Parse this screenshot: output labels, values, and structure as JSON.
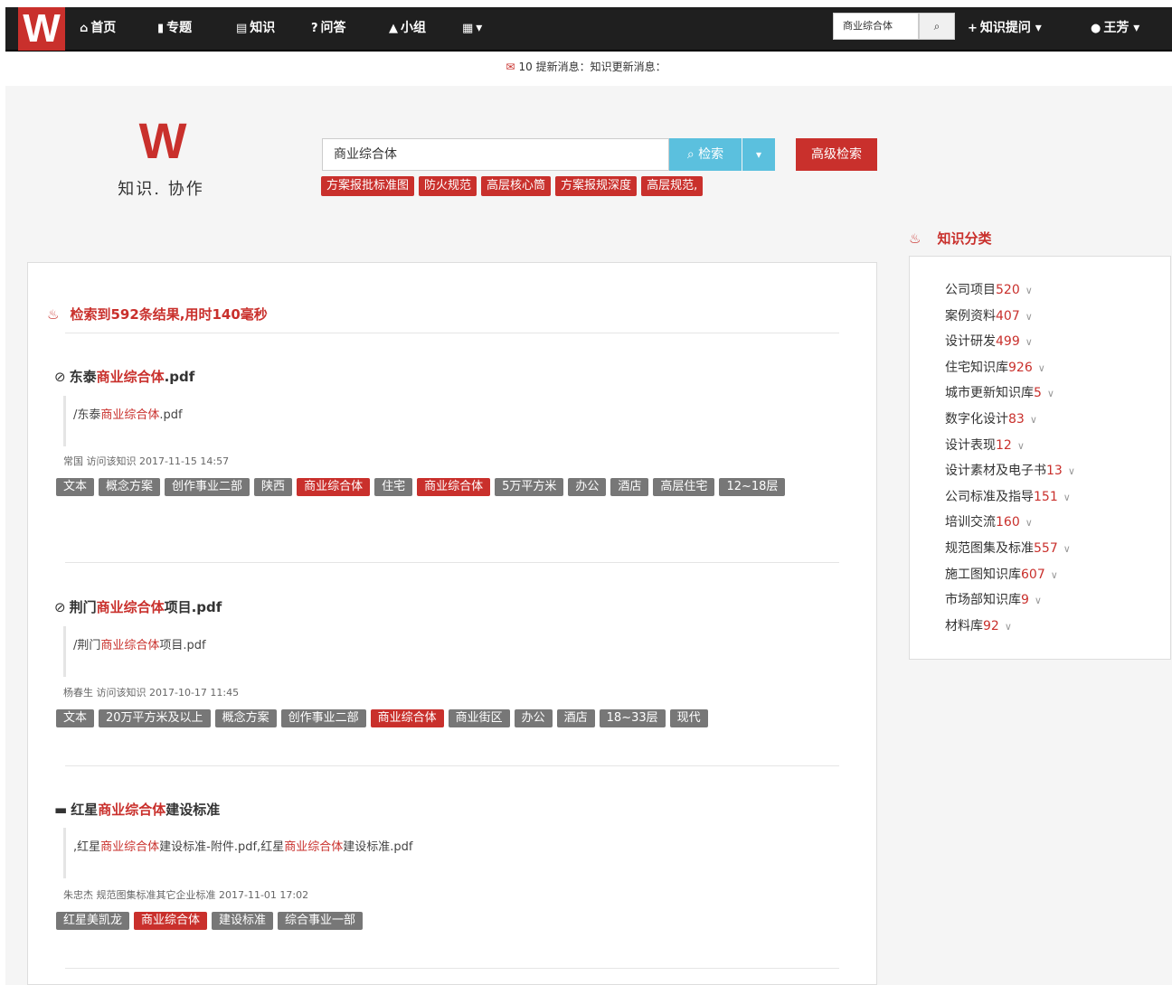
{
  "nav": {
    "logo": "W",
    "items": [
      {
        "icon": "home-icon",
        "glyph": "⌂",
        "label": "首页"
      },
      {
        "icon": "bookmark-icon",
        "glyph": "▮",
        "label": "专题"
      },
      {
        "icon": "book-icon",
        "glyph": "▤",
        "label": "知识"
      },
      {
        "icon": "question-icon",
        "glyph": "?",
        "label": "问答"
      },
      {
        "icon": "bell-icon",
        "glyph": "▲",
        "label": "小组"
      },
      {
        "icon": "grid-icon",
        "glyph": "▦",
        "label": "▾"
      }
    ],
    "search_value": "商业综合体",
    "search_icon": "⌕",
    "ask_glyph": "+",
    "ask_label": "知识提问 ▾",
    "user_glyph": "●",
    "user_label": "王芳 ▾"
  },
  "notify": {
    "mail_icon": "✉",
    "text": "10 提新消息：知识更新消息："
  },
  "brand": {
    "mark": "W",
    "slogan": "知识. 协作"
  },
  "search": {
    "value": "商业综合体",
    "button_label": "⌕ 检索",
    "caret": "▾",
    "advanced_label": "高级检索",
    "hot_tags": [
      "方案报批标准图",
      "防火规范",
      "高层核心筒",
      "方案报规深度",
      "高层规范,"
    ]
  },
  "results": {
    "fire_icon": "♨",
    "summary": "检索到592条结果,用时140毫秒",
    "items": [
      {
        "icon_glyph": "⊘",
        "icon_name": "paperclip-icon",
        "title_pre": "东泰",
        "title_hl": "商业综合体",
        "title_post": ".pdf",
        "path_pre": "/东泰",
        "path_hl": "商业综合体",
        "path_post": ".pdf",
        "path2_hl": "",
        "path2_post": "",
        "meta": "常国 访问该知识 2017-11-15 14:57",
        "tags": [
          {
            "t": "文本",
            "red": false
          },
          {
            "t": "概念方案",
            "red": false
          },
          {
            "t": "创作事业二部",
            "red": false
          },
          {
            "t": "陕西",
            "red": false
          },
          {
            "t": "商业综合体",
            "red": true
          },
          {
            "t": "住宅",
            "red": false
          },
          {
            "t": "商业综合体",
            "red": true
          },
          {
            "t": "5万平方米",
            "red": false
          },
          {
            "t": "办公",
            "red": false
          },
          {
            "t": "酒店",
            "red": false
          },
          {
            "t": "高层住宅",
            "red": false
          },
          {
            "t": "12~18层",
            "red": false
          }
        ]
      },
      {
        "icon_glyph": "⊘",
        "icon_name": "paperclip-icon",
        "title_pre": "荆门",
        "title_hl": "商业综合体",
        "title_post": "项目.pdf",
        "path_pre": "/荆门",
        "path_hl": "商业综合体",
        "path_post": "项目.pdf",
        "path2_hl": "",
        "path2_post": "",
        "meta": "杨春生 访问该知识 2017-10-17 11:45",
        "tags": [
          {
            "t": "文本",
            "red": false
          },
          {
            "t": "20万平方米及以上",
            "red": false
          },
          {
            "t": "概念方案",
            "red": false
          },
          {
            "t": "创作事业二部",
            "red": false
          },
          {
            "t": "商业综合体",
            "red": true
          },
          {
            "t": "商业街区",
            "red": false
          },
          {
            "t": "办公",
            "red": false
          },
          {
            "t": "酒店",
            "red": false
          },
          {
            "t": "18~33层",
            "red": false
          },
          {
            "t": "现代",
            "red": false
          }
        ]
      },
      {
        "icon_glyph": "▬",
        "icon_name": "list-icon",
        "title_pre": "红星",
        "title_hl": "商业综合体",
        "title_post": "建设标准",
        "path_pre": ",红星",
        "path_hl": "商业综合体",
        "path_post": "建设标准-附件.pdf,红星",
        "path2_hl": "商业综合体",
        "path2_post": "建设标准.pdf",
        "meta": "朱忠杰 规范图集标准其它企业标准 2017-11-01 17:02",
        "tags": [
          {
            "t": "红星美凯龙",
            "red": false
          },
          {
            "t": "商业综合体",
            "red": true
          },
          {
            "t": "建设标准",
            "red": false
          },
          {
            "t": "综合事业一部",
            "red": false
          }
        ]
      }
    ]
  },
  "categories": {
    "fire_icon": "♨",
    "title": "知识分类",
    "chevron": "∨",
    "items": [
      {
        "name": "公司项目",
        "count": "520"
      },
      {
        "name": "案例资料",
        "count": "407"
      },
      {
        "name": "设计研发",
        "count": "499"
      },
      {
        "name": "住宅知识库",
        "count": "926"
      },
      {
        "name": "城市更新知识库",
        "count": "5"
      },
      {
        "name": "数字化设计",
        "count": "83"
      },
      {
        "name": "设计表现",
        "count": "12"
      },
      {
        "name": "设计素材及电子书",
        "count": "13"
      },
      {
        "name": "公司标准及指导",
        "count": "151"
      },
      {
        "name": "培训交流",
        "count": "160"
      },
      {
        "name": "规范图集及标准",
        "count": "557"
      },
      {
        "name": "施工图知识库",
        "count": "607"
      },
      {
        "name": "市场部知识库",
        "count": "9"
      },
      {
        "name": "材料库",
        "count": "92"
      }
    ]
  }
}
